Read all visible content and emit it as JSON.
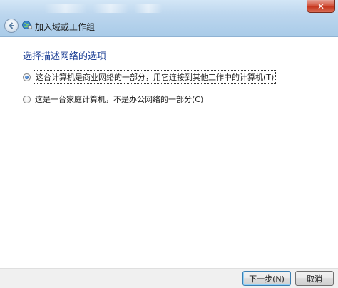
{
  "window": {
    "close_glyph": "✕"
  },
  "header": {
    "title": "加入域或工作组"
  },
  "main": {
    "heading": "选择描述网络的选项",
    "options": [
      {
        "label": "这台计算机是商业网络的一部分，用它连接到其他工作中的计算机(T)",
        "checked": true
      },
      {
        "label": "这是一台家庭计算机，不是办公网络的一部分(C)",
        "checked": false
      }
    ]
  },
  "footer": {
    "next_label": "下一步(N)",
    "cancel_label": "取消"
  }
}
